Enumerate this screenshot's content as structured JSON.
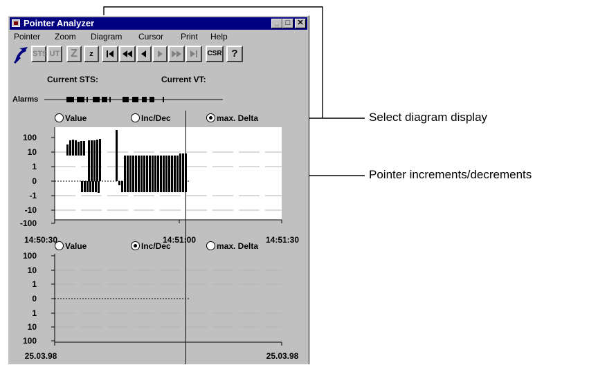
{
  "window": {
    "title": "Pointer Analyzer"
  },
  "menu": [
    "Pointer",
    "Zoom",
    "Diagram",
    "Cursor",
    "Print",
    "Help"
  ],
  "toolbar": {
    "sts": "STS",
    "ut": "UT",
    "z_large": "Z",
    "z_small": "z",
    "csr": "CSR",
    "help": "?"
  },
  "status": {
    "current_sts": "Current STS:",
    "current_vt": "Current VT:"
  },
  "alarms_label": "Alarms",
  "diagram1": {
    "options": [
      "Value",
      "Inc/Dec",
      "max. Delta"
    ],
    "selected": "max. Delta",
    "y_ticks": [
      "100",
      "10",
      "1",
      "0",
      "-1",
      "-10",
      "-100"
    ],
    "x_ticks": [
      "14:50:30",
      "14:51:00",
      "14:51:30"
    ]
  },
  "diagram2": {
    "options": [
      "Value",
      "Inc/Dec",
      "max. Delta"
    ],
    "selected": "Inc/Dec",
    "y_ticks": [
      "100",
      "10",
      "1",
      "0",
      "1",
      "10",
      "100"
    ],
    "x_ticks": [
      "25.03.98",
      "25.03.98"
    ]
  },
  "annotations": {
    "select_display": "Select diagram display",
    "pointer_inc": "Pointer increments/decrements"
  }
}
